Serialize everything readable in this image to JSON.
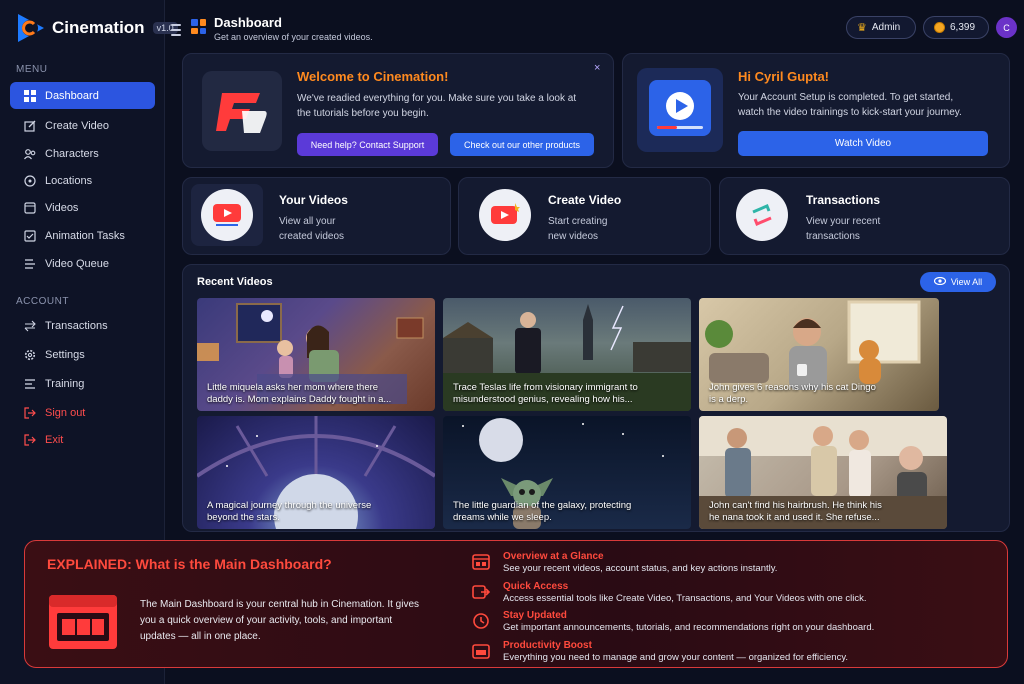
{
  "brand": {
    "name": "Cinemation",
    "version": "v1.0"
  },
  "sidebar": {
    "menu_label": "MENU",
    "account_label": "ACCOUNT",
    "items": [
      {
        "label": "Dashboard",
        "icon": "dashboard-icon"
      },
      {
        "label": "Create Video",
        "icon": "edit-icon"
      },
      {
        "label": "Characters",
        "icon": "users-icon"
      },
      {
        "label": "Locations",
        "icon": "location-icon"
      },
      {
        "label": "Videos",
        "icon": "video-icon"
      },
      {
        "label": "Animation Tasks",
        "icon": "tasks-icon"
      },
      {
        "label": "Video Queue",
        "icon": "queue-icon"
      }
    ],
    "account_items": [
      {
        "label": "Transactions",
        "icon": "transactions-icon"
      },
      {
        "label": "Settings",
        "icon": "gear-icon"
      },
      {
        "label": "Training",
        "icon": "training-icon"
      },
      {
        "label": "Sign out",
        "icon": "signout-icon"
      },
      {
        "label": "Exit",
        "icon": "exit-icon"
      }
    ]
  },
  "header": {
    "title": "Dashboard",
    "subtitle": "Get an overview of your created videos.",
    "role": "Admin",
    "credits": "6,399",
    "avatar_initial": "C"
  },
  "welcome": {
    "title": "Welcome to Cinemation!",
    "body": "We've readied everything for you. Make sure you take a look at the tutorials before you begin.",
    "support_button": "Need help? Contact Support",
    "products_button": "Check out our other products",
    "close": "×"
  },
  "greeting": {
    "title": "Hi Cyril Gupta!",
    "body": "Your Account Setup is completed. To get started, watch the video trainings to kick-start your journey.",
    "button": "Watch Video"
  },
  "quick_cards": [
    {
      "title": "Your Videos",
      "line1": "View all your",
      "line2": "created videos"
    },
    {
      "title": "Create Video",
      "line1": "Start creating",
      "line2": "new videos"
    },
    {
      "title": "Transactions",
      "line1": "View your recent",
      "line2": "transactions"
    }
  ],
  "recent": {
    "title": "Recent Videos",
    "view_all": "View All",
    "videos": [
      {
        "line1": "Little miquela asks her mom where there",
        "line2": "daddy is. Mom explains Daddy fought in a..."
      },
      {
        "line1": "Trace Teslas life from visionary immigrant to",
        "line2": "misunderstood genius, revealing how his..."
      },
      {
        "line1": "John gives 6 reasons why his cat Dingo",
        "line2": "is a derp."
      },
      {
        "line1": "A magical journey through the universe",
        "line2": "beyond the stars."
      },
      {
        "line1": "The little guardian of the galaxy, protecting",
        "line2": "dreams while we sleep."
      },
      {
        "line1": "John can't find his hairbrush. He think his",
        "line2": "he nana took it and used it. She refuse..."
      }
    ]
  },
  "explained": {
    "title": "EXPLAINED: What is the Main Dashboard?",
    "body": "The Main Dashboard is your central hub in Cinemation. It gives you a quick overview of your activity, tools, and important updates — all in one place.",
    "items": [
      {
        "title": "Overview at a Glance",
        "desc": "See your recent videos, account status, and key actions instantly."
      },
      {
        "title": "Quick Access",
        "desc": "Access essential tools like Create Video, Transactions, and Your Videos with one click."
      },
      {
        "title": "Stay Updated",
        "desc": "Get important announcements, tutorials, and recommendations right on your dashboard."
      },
      {
        "title": "Productivity Boost",
        "desc": "Everything you need to manage and grow your content — organized for efficiency."
      }
    ]
  },
  "colors": {
    "accent": "#2c63e8",
    "active_nav": "#2c55e0",
    "orange": "#ff8a1f",
    "danger": "#ff4d4d"
  }
}
